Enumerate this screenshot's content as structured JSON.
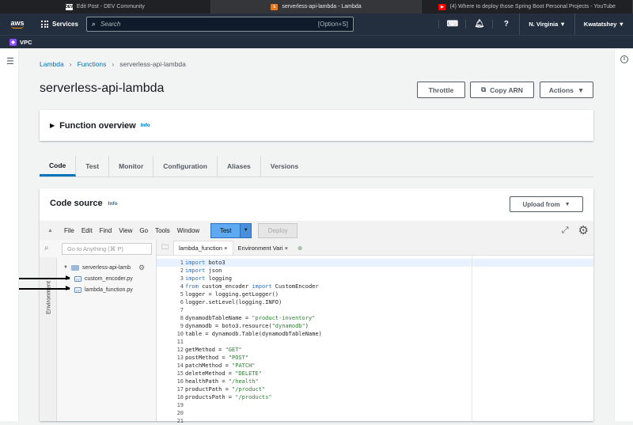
{
  "browser_tabs": [
    {
      "favicon": "DEV",
      "title": "Edit Post - DEV Community",
      "active": false
    },
    {
      "favicon": "lambda",
      "title": "serverless-api-lambda - Lambda",
      "active": true
    },
    {
      "favicon": "youtube",
      "title": "(4) Where to deploy those Spring Boot Personal Projects - YouTube",
      "active": false
    }
  ],
  "aws_nav": {
    "logo": "aws",
    "services": "Services",
    "search_placeholder": "Search",
    "search_shortcut": "[Option+S]",
    "region": "N. Virginia ▼",
    "user": "Kwatatshey ▼"
  },
  "favorites": {
    "vpc": "VPC"
  },
  "breadcrumb": {
    "root": "Lambda",
    "section": "Functions",
    "current": "serverless-api-lambda"
  },
  "page_title": "serverless-api-lambda",
  "header_buttons": {
    "throttle": "Throttle",
    "copy_arn": "Copy ARN",
    "actions": "Actions"
  },
  "overview": {
    "title": "Function overview",
    "info": "Info"
  },
  "tabs": [
    "Code",
    "Test",
    "Monitor",
    "Configuration",
    "Aliases",
    "Versions"
  ],
  "code_source": {
    "title": "Code source",
    "info": "Info",
    "upload": "Upload from"
  },
  "ide_menu": [
    "File",
    "Edit",
    "Find",
    "View",
    "Go",
    "Tools",
    "Window"
  ],
  "ide_buttons": {
    "test": "Test",
    "deploy": "Deploy"
  },
  "sidebar": {
    "goto_placeholder": "Go to Anything (⌘ P)",
    "environment": "Environment",
    "folder": "serverless-api-lamb",
    "files": [
      "custom_encoder.py",
      "lambda_function.py"
    ]
  },
  "editor_tabs": [
    "lambda_function ×",
    "Environment Vari ×"
  ],
  "code_lines": [
    "import boto3",
    "import json",
    "import logging",
    "from custom_encoder import CustomEncoder",
    "logger = logging.getLogger()",
    "logger.setLevel(logging.INFO)",
    "",
    "dynamodbTableName = \"product-inventory\"",
    "dynamodb = boto3.resource(\"dynamodb\")",
    "table = dynamodb.Table(dynamodbTableName)",
    "",
    "getMethod = \"GET\"",
    "postMethod = \"POST\"",
    "patchMethod = \"PATCH\"",
    "deleteMethod = \"DELETE\"",
    "healthPath = \"/health\"",
    "productPath = \"/product\"",
    "productsPath = \"/products\"",
    "",
    "",
    ""
  ]
}
